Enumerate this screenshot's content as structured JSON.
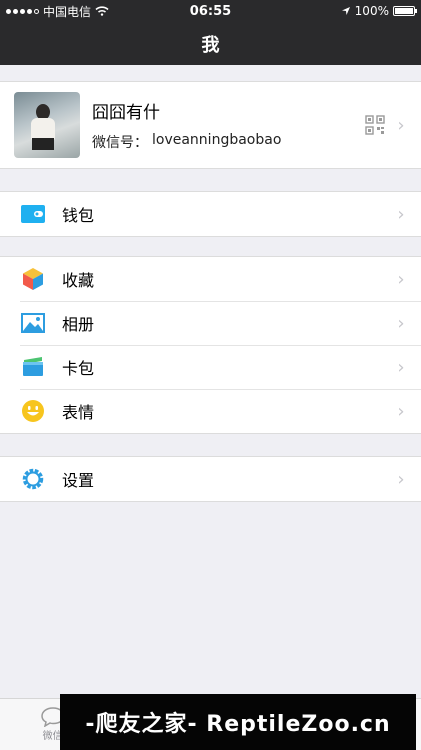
{
  "status_bar": {
    "carrier": "中国电信",
    "time": "06:55",
    "battery_percent": "100%",
    "battery_level": 1.0,
    "signal_bars": 4
  },
  "nav": {
    "title": "我"
  },
  "profile": {
    "name": "囧囧有什",
    "wechat_label": "微信号：",
    "wechat_id": "loveanningbaobao"
  },
  "wallet": {
    "label": "钱包"
  },
  "menu": [
    {
      "label": "收藏",
      "icon": "favorites-cube-icon"
    },
    {
      "label": "相册",
      "icon": "album-picture-icon"
    },
    {
      "label": "卡包",
      "icon": "card-wallet-icon"
    },
    {
      "label": "表情",
      "icon": "sticker-smile-icon"
    }
  ],
  "settings": {
    "label": "设置"
  },
  "tabbar": {
    "tab1": "微信"
  },
  "watermark": {
    "text": "-爬友之家- ReptileZoo.cn"
  },
  "colors": {
    "nav_bg": "#2a2a2c",
    "accent_blue": "#1fb0f0",
    "page_bg": "#efeff4"
  }
}
